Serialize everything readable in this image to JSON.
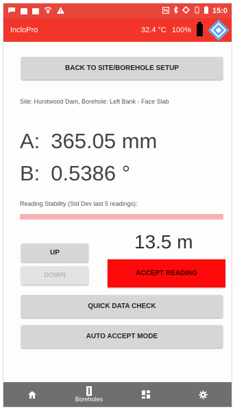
{
  "status_bar": {
    "time": "15:0",
    "icons": [
      "message-icon",
      "image-icon",
      "image-icon",
      "wifi-icon",
      "warning-icon"
    ],
    "right_icons": [
      "nfc-icon",
      "bluetooth-icon",
      "sync-icon",
      "vibrate-icon",
      "battery-icon"
    ]
  },
  "app_bar": {
    "title": "IncloPro",
    "temperature": "32.4 °C",
    "battery_percent": "100%"
  },
  "buttons": {
    "back": "BACK TO SITE/BOREHOLE SETUP",
    "up": "UP",
    "down": "DOWN",
    "accept": "ACCEPT READING",
    "quick_check": "QUICK DATA CHECK",
    "auto_accept": "AUTO ACCEPT MODE"
  },
  "site_info": "Site: Hurstwood Dam, Borehole: Left Bank - Face Slab",
  "readings": {
    "a_label": "A:",
    "a_value": "365.05 mm",
    "b_label": "B:",
    "b_value": "0.5386 °"
  },
  "stability": {
    "label": "Reading Stability (Std Dev last 5 readings):",
    "level": 1.0
  },
  "depth": "13.5 m",
  "nav": {
    "boreholes_label": "Boreholes"
  },
  "colors": {
    "accent": "#f2352a",
    "accept": "#ff0a0a",
    "nav": "#6f6f6f"
  }
}
